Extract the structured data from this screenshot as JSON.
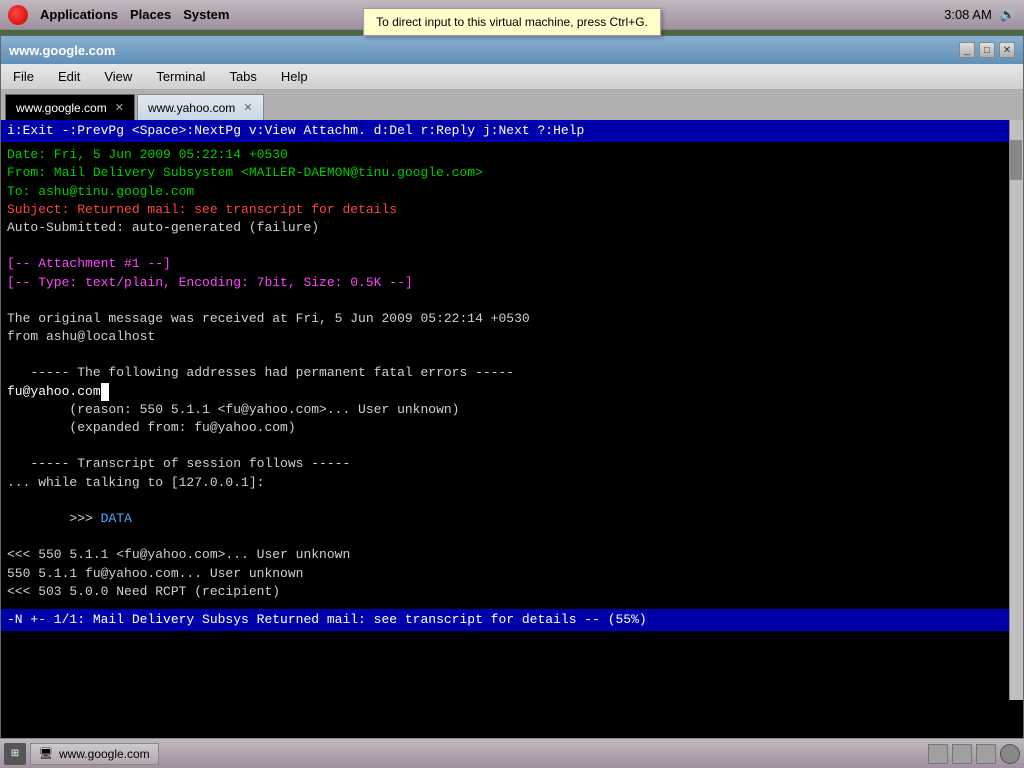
{
  "system_bar": {
    "app_label": "Applications",
    "places_label": "Places",
    "system_label": "System",
    "time": "3:08 AM"
  },
  "tooltip": {
    "text": "To direct input to this virtual machine, press Ctrl+G."
  },
  "terminal": {
    "title": "www.google.com",
    "tabs": [
      {
        "label": "www.google.com",
        "active": true
      },
      {
        "label": "www.yahoo.com",
        "active": false
      }
    ],
    "menu": [
      "File",
      "Edit",
      "View",
      "Terminal",
      "Tabs",
      "Help"
    ],
    "cmd_bar": "i:Exit  -:PrevPg  <Space>:NextPg v:View Attachm.  d:Del  r:Reply  j:Next ?:Help",
    "email": {
      "date_line": "Date: Fri, 5 Jun 2009 05:22:14 +0530",
      "from_line": "From: Mail Delivery Subsystem <MAILER-DAEMON@tinu.google.com>",
      "to_line": "To: ashu@tinu.google.com",
      "subject_line": "Subject: Returned mail: see transcript for details",
      "auto_submitted": "Auto-Submitted: auto-generated (failure)",
      "blank1": "",
      "attachment1": "[-- Attachment #1 --]",
      "attachment2": "[-- Type: text/plain, Encoding: 7bit, Size: 0.5K --]",
      "blank2": "",
      "original_msg": "The original message was received at Fri, 5 Jun 2009 05:22:14 +0530",
      "from_localhost": "from ashu@localhost",
      "blank3": "",
      "fatal_errors": "   ----- The following addresses had permanent fatal errors -----",
      "bad_address": "fu@yahoo.com",
      "reason": "        (reason: 550 5.1.1 <fu@yahoo.com>... User unknown)",
      "expanded": "        (expanded from: fu@yahoo.com)",
      "blank4": "",
      "transcript": "   ----- Transcript of session follows -----",
      "while_talking": "... while talking to [127.0.0.1]:",
      "data_cmd": ">>> DATA",
      "resp1": "<<< 550 5.1.1 <fu@yahoo.com>... User unknown",
      "resp2": "550 5.1.1 fu@yahoo.com... User unknown",
      "resp3": "<<< 503 5.0.0 Need RCPT (recipient)"
    },
    "status_bar": "-N +- 1/1: Mail Delivery Subsys    Returned mail: see transcript for details           -- (55%)"
  },
  "taskbar": {
    "item_label": "www.google.com"
  }
}
